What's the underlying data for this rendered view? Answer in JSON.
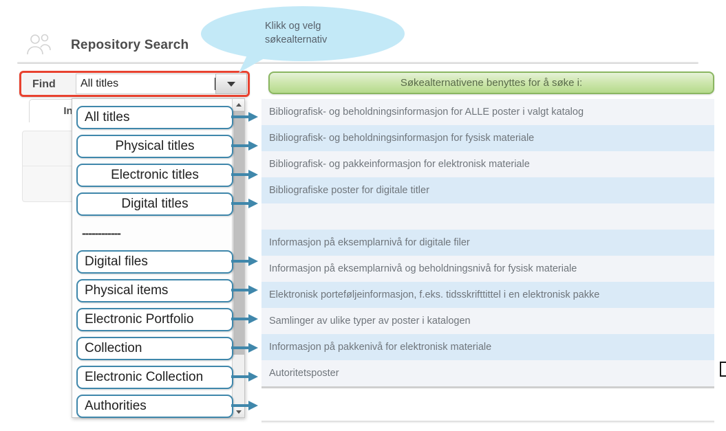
{
  "header": {
    "title": "Repository Search",
    "icon": "users-icon"
  },
  "find_bar": {
    "label": "Find",
    "value": "All titles",
    "placeholder": "All titles",
    "dropdown_icon": "chevron-down-icon",
    "highlight_color": "#e8422f"
  },
  "tab": {
    "label": "Inst"
  },
  "callout": {
    "line1": "Klikk og velg",
    "line2": "søkealternativ",
    "fill_color": "#c3e9f7"
  },
  "banner": {
    "text": "Søkealternativene benyttes for å søke i:",
    "color": "#b5da8b"
  },
  "dropdown": {
    "options": [
      {
        "label": "All titles",
        "align": "left",
        "type": "option"
      },
      {
        "label": "Physical titles",
        "align": "center",
        "type": "option"
      },
      {
        "label": "Electronic titles",
        "align": "center",
        "type": "option"
      },
      {
        "label": "Digital titles",
        "align": "center",
        "type": "option"
      },
      {
        "label": "------------",
        "align": "left",
        "type": "separator"
      },
      {
        "label": "Digital files",
        "align": "left",
        "type": "option"
      },
      {
        "label": "Physical items",
        "align": "left",
        "type": "option"
      },
      {
        "label": "Electronic Portfolio",
        "align": "left",
        "type": "option"
      },
      {
        "label": "Collection",
        "align": "left",
        "type": "option"
      },
      {
        "label": "Electronic Collection",
        "align": "left",
        "type": "option"
      },
      {
        "label": "Authorities",
        "align": "left",
        "type": "option"
      }
    ],
    "border_color": "#3f87ab"
  },
  "descriptions": [
    {
      "text": "Bibliografisk- og beholdningsinformasjon for ALLE poster i valgt katalog",
      "shade": "odd",
      "arrow": true
    },
    {
      "text": "Bibliografisk- og beholdningsinformasjon for fysisk materiale",
      "shade": "even",
      "arrow": true
    },
    {
      "text": "Bibliografisk- og pakkeinformasjon for elektronisk materiale",
      "shade": "odd",
      "arrow": true
    },
    {
      "text": "Bibliografiske poster for digitale titler",
      "shade": "even",
      "arrow": true
    },
    {
      "text": "",
      "shade": "odd",
      "arrow": false
    },
    {
      "text": "Informasjon på eksemplarnivå for digitale filer",
      "shade": "even",
      "arrow": true
    },
    {
      "text": "Informasjon på eksemplarnivå og beholdningsnivå for fysisk materiale",
      "shade": "odd",
      "arrow": true
    },
    {
      "text": "Elektronisk porteføljeinformasjon, f.eks. tidsskrifttittel i en elektronisk pakke",
      "shade": "even",
      "arrow": true
    },
    {
      "text": "Samlinger av ulike typer av poster i katalogen",
      "shade": "odd",
      "arrow": true
    },
    {
      "text": "Informasjon på pakkenivå for elektronisk materiale",
      "shade": "even",
      "arrow": true
    },
    {
      "text": "Autoritetsposter",
      "shade": "odd",
      "arrow": true
    }
  ],
  "arrow_color": "#3f87ab"
}
